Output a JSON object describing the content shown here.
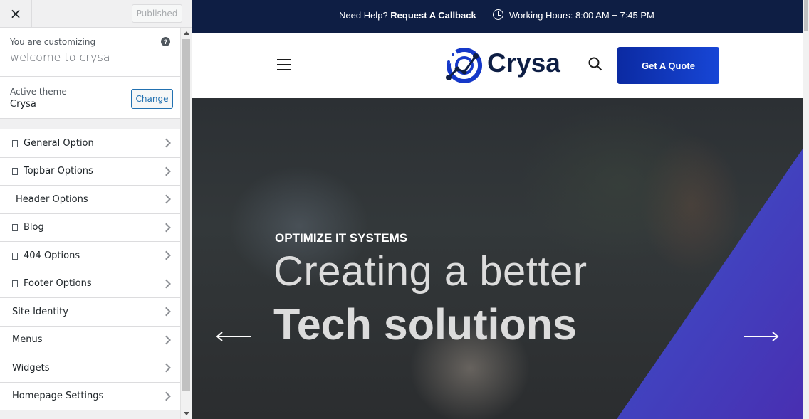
{
  "customizer": {
    "close_label": "×",
    "published_label": "Published",
    "customizing_label": "You are customizing",
    "site_title": "welcome to crysa",
    "help_icon": "?",
    "active_theme_label": "Active theme",
    "theme_name": "Crysa",
    "change_label": "Change",
    "menu": [
      {
        "label": "General Option",
        "icon": true
      },
      {
        "label": "Topbar Options",
        "icon": true
      },
      {
        "label": "Header Options",
        "icon": false
      },
      {
        "label": "Blog",
        "icon": true
      },
      {
        "label": "404 Options",
        "icon": true
      },
      {
        "label": "Footer Options",
        "icon": true
      },
      {
        "label": "Site Identity",
        "icon": false
      },
      {
        "label": "Menus",
        "icon": false
      },
      {
        "label": "Widgets",
        "icon": false
      },
      {
        "label": "Homepage Settings",
        "icon": false
      }
    ]
  },
  "site": {
    "topbar": {
      "help_prefix": "Need Help?",
      "help_link": "Request A Callback",
      "hours": "Working Hours: 8:00 AM − 7:45 PM"
    },
    "logo_text": "Crysa",
    "quote_button": "Get A Quote",
    "hero": {
      "eyebrow": "OPTIMIZE IT SYSTEMS",
      "line1": "Creating a better",
      "line2": "Tech solutions"
    }
  },
  "colors": {
    "topbar_bg": "#0e1e44",
    "brand_blue": "#1746d6",
    "wp_blue": "#2271b1"
  }
}
